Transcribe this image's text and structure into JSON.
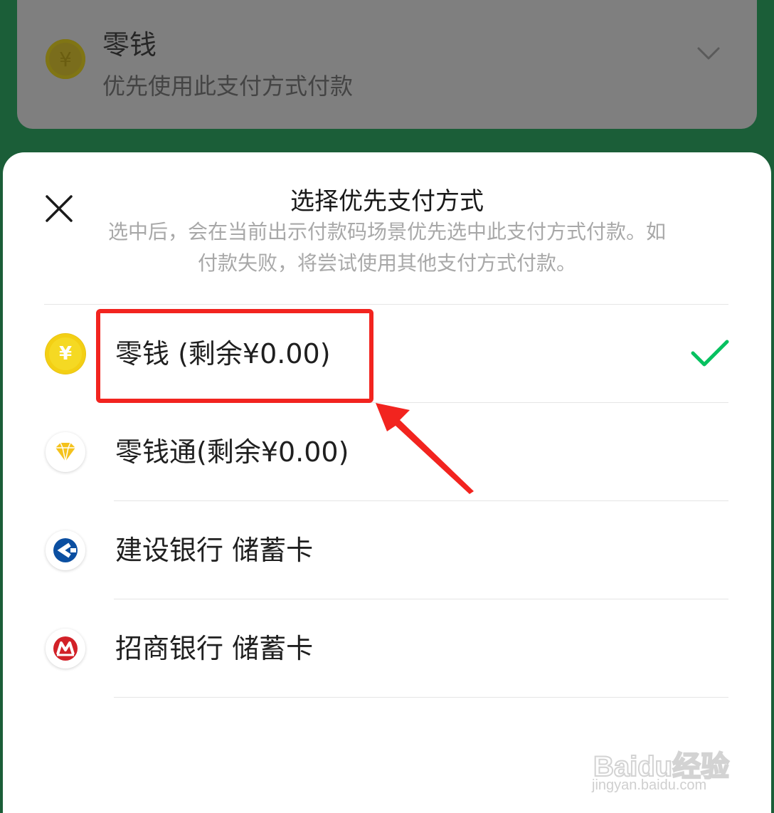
{
  "background_card": {
    "title": "零钱",
    "subtitle": "优先使用此支付方式付款",
    "coin_symbol": "¥"
  },
  "sheet": {
    "title": "选择优先支付方式",
    "description": "选中后，会在当前出示付款码场景优先选中此支付方式付款。如付款失败，将尝试使用其他支付方式付款。",
    "options": [
      {
        "label": "零钱 (剩余¥0.00)",
        "icon": "coin-icon",
        "selected": true
      },
      {
        "label": "零钱通(剩余¥0.00)",
        "icon": "diamond-icon",
        "selected": false
      },
      {
        "label": "建设银行 储蓄卡",
        "icon": "ccb-bank-icon",
        "selected": false
      },
      {
        "label": "招商银行 储蓄卡",
        "icon": "cmb-bank-icon",
        "selected": false
      }
    ]
  },
  "watermark": {
    "logo_text": "Baidu经验",
    "url": "jingyan.baidu.com"
  },
  "colors": {
    "header_bg": "#1b5e38",
    "check_green": "#07c160",
    "annotation_red": "#f2241f",
    "coin_yellow": "#f5d923"
  }
}
